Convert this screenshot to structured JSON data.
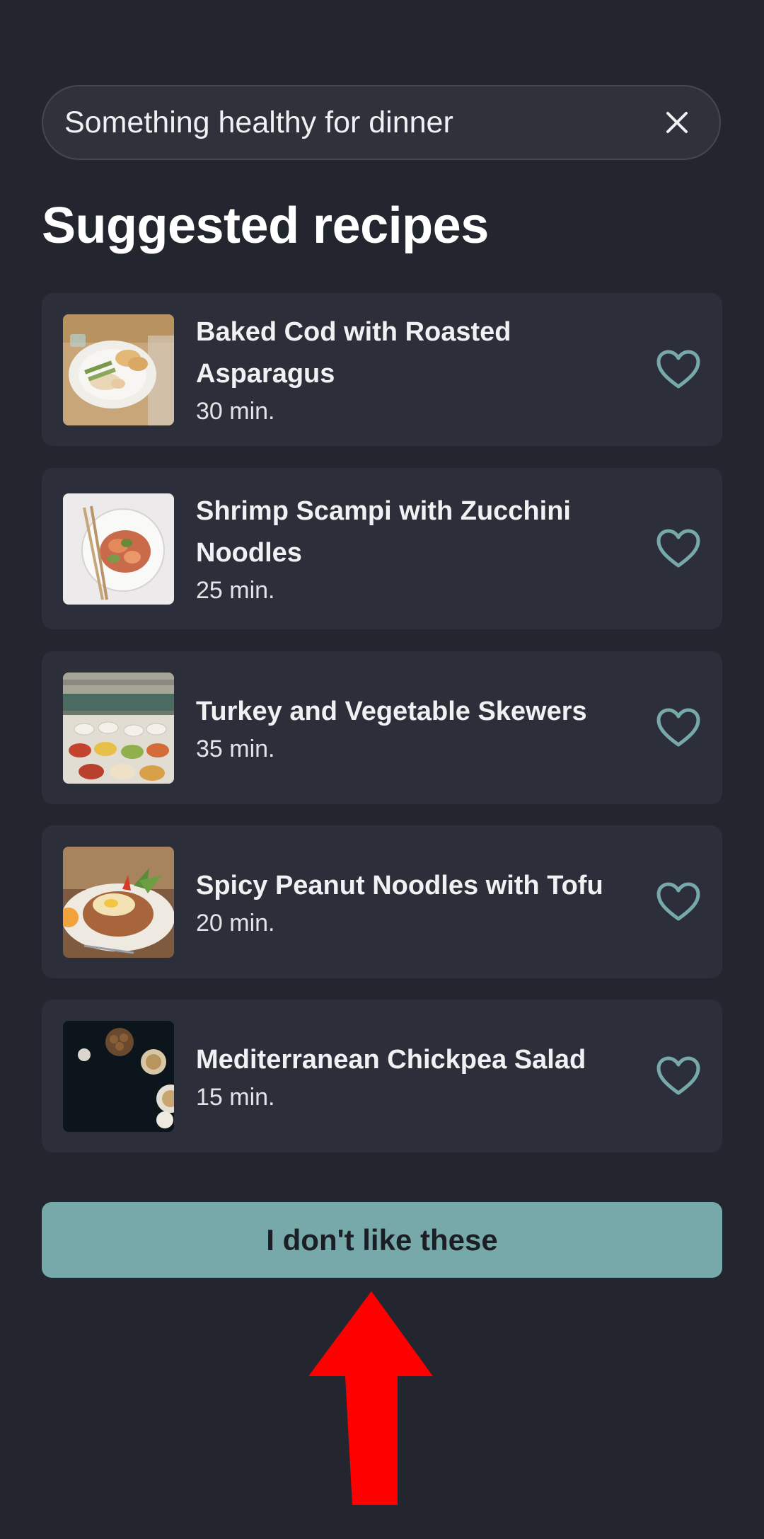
{
  "search": {
    "value": "Something healthy for dinner",
    "placeholder": ""
  },
  "page_title": "Suggested recipes",
  "recipes": [
    {
      "title": "Baked Cod with Roasted Asparagus",
      "time": "30 min.",
      "image": "plated-cod-photo",
      "favorite_icon": "heart-outline-icon"
    },
    {
      "title": "Shrimp Scampi with Zucchini Noodles",
      "time": "25 min.",
      "image": "shrimp-plate-photo",
      "favorite_icon": "heart-outline-icon"
    },
    {
      "title": "Turkey and Vegetable Skewers",
      "time": "35 min.",
      "image": "table-spread-photo",
      "favorite_icon": "heart-outline-icon"
    },
    {
      "title": "Spicy Peanut Noodles with Tofu",
      "time": "20 min.",
      "image": "noodle-dish-photo",
      "favorite_icon": "heart-outline-icon"
    },
    {
      "title": "Mediterranean Chickpea Salad",
      "time": "15 min.",
      "image": "dark-table-bowls-photo",
      "favorite_icon": "heart-outline-icon"
    }
  ],
  "dislike_button_label": "I don't like these",
  "colors": {
    "background": "#23262f",
    "card": "#2c2f39",
    "accent": "#78a9aa",
    "annotation_arrow": "#ff0000"
  }
}
